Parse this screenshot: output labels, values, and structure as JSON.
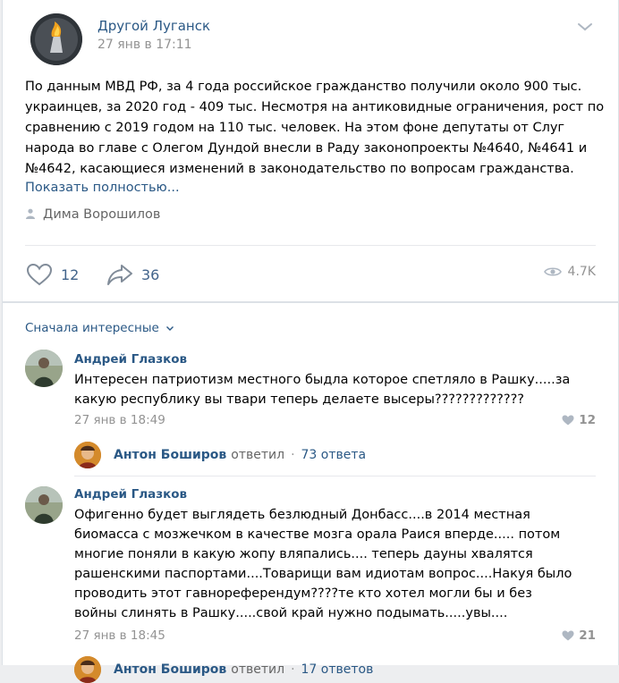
{
  "post": {
    "group_name": "Другой Луганск",
    "date": "27 янв в 17:11",
    "text": "По данным МВД РФ, за 4 года российское гражданство получили около 900 тыс. украинцев, за 2020 год - 409 тыс. Несмотря на антиковидные ограничения, рост по сравнению с 2019 годом на 110 тыс. человек. На этом фоне депутаты от Слуг народа во главе с Олегом Дундой внесли в Раду законопроекты №4640, №4641 и №4642, касающиеся изменений в законодательство по вопросам гражданства.",
    "show_more": "Показать полностью...",
    "author": "Дима Ворошилов",
    "likes": "12",
    "shares": "36",
    "views": "4.7K"
  },
  "comments": {
    "sort_label": "Сначала интересные",
    "items": [
      {
        "author": "Андрей Глазков",
        "text": "Интересен патриотизм местного быдла которое спетляло в Рашку.....за какую республику вы твари теперь делаете высеры?????????????",
        "date": "27 янв в 18:49",
        "likes": "12",
        "reply": {
          "name": "Антон Боширов",
          "verb": "ответил",
          "dot": "·",
          "count": "73 ответа"
        }
      },
      {
        "author": "Андрей Глазков",
        "text": "Офигенно будет выглядеть безлюдный Донбасс....в 2014 местная биомасса с мозжечком в качестве мозга орала Раися вперде..... потом многие поняли в какую жопу вляпались.... теперь дауны хвалятся рашенскими паспортами....Товарищи вам идиотам вопрос....Накуя было проводить этот гавнореферендум????те кто хотел могли бы и без войны слинять в Рашку.....свой край нужно подымать.....увы....",
        "date": "27 янв в 18:45",
        "likes": "21",
        "reply": {
          "name": "Антон Боширов",
          "verb": "ответил",
          "dot": "·",
          "count": "17 ответов"
        }
      }
    ]
  },
  "colors": {
    "link": "#2a5885",
    "muted": "#939393",
    "background": "#edeef0"
  },
  "icons": [
    "group-avatar-icon",
    "chevron-down-icon",
    "person-icon",
    "heart-icon",
    "share-arrow-icon",
    "eye-icon"
  ]
}
